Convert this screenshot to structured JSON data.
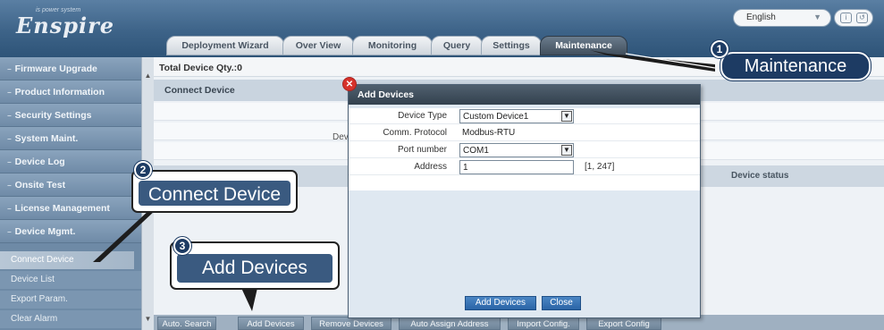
{
  "app": {
    "logo": "Enspire",
    "logo_sub": "is power system",
    "language": "English"
  },
  "tabs": [
    "Deployment Wizard",
    "Over View",
    "Monitoring",
    "Query",
    "Settings",
    "Maintenance"
  ],
  "active_tab": "Maintenance",
  "sidebar": {
    "items": [
      "Firmware Upgrade",
      "Product Information",
      "Security Settings",
      "System Maint.",
      "Device Log",
      "Onsite Test",
      "License Management",
      "Device Mgmt."
    ],
    "sub_items": [
      "Connect Device",
      "Device List",
      "Export Param.",
      "Clear Alarm"
    ],
    "active_sub": "Connect Device"
  },
  "main": {
    "total_qty": "Total Device Qty.:0",
    "connect_header": "Connect Device",
    "dev_text": "Dev",
    "device_status_col": "Device status",
    "buttons": [
      "Auto. Search",
      "Add Devices",
      "Remove Devices",
      "Auto Assign Address",
      "Import Config.",
      "Export Config"
    ]
  },
  "dialog": {
    "title": "Add Devices",
    "fields": {
      "device_type_label": "Device Type",
      "device_type_value": "Custom Device1",
      "comm_protocol_label": "Comm. Protocol",
      "comm_protocol_value": "Modbus-RTU",
      "port_number_label": "Port number",
      "port_number_value": "COM1",
      "address_label": "Address",
      "address_value": "1",
      "address_range": "[1, 247]"
    },
    "add_button": "Add Devices",
    "close_button": "Close"
  },
  "callouts": {
    "one": {
      "num": "1",
      "text": "Maintenance"
    },
    "two": {
      "num": "2",
      "text": "Connect Device"
    },
    "three": {
      "num": "3",
      "text": "Add Devices"
    }
  },
  "colors": {
    "header": "#3d6388",
    "sidebar": "#6e8aa6",
    "callout": "#1d3b63",
    "dialog_button": "#2a64a6",
    "close_icon": "#d6322b"
  }
}
